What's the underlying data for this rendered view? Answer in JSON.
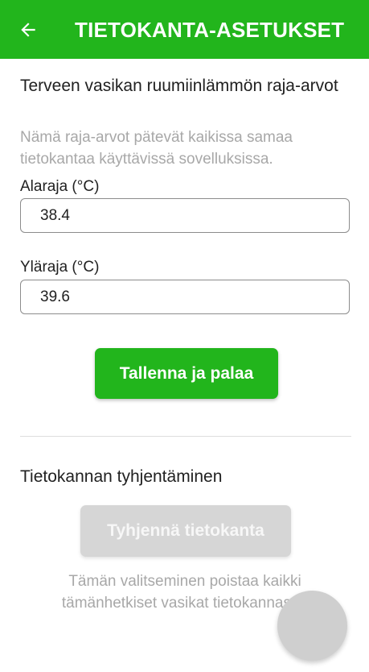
{
  "appbar": {
    "title": "TIETOKANTA-ASETUKSET",
    "back_icon": "arrow-left-icon",
    "color": "#22b51c"
  },
  "temperature_limits": {
    "title": "Terveen vasikan ruumiinlämmön raja-arvot",
    "description": "Nämä raja-arvot pätevät kaikissa samaa tietokantaa käyttävissä sovelluksissa.",
    "lower": {
      "label": "Alaraja (°C)",
      "value": "38.4"
    },
    "upper": {
      "label": "Yläraja (°C)",
      "value": "39.6"
    },
    "save_label": "Tallenna ja palaa"
  },
  "database_clear": {
    "title": "Tietokannan tyhjentäminen",
    "button_label": "Tyhjennä tietokanta",
    "description": "Tämän valitseminen poistaa kaikki tämänhetkiset vasikat tietokannasta."
  },
  "colors": {
    "accent": "#22b51c",
    "disabled_button": "#d6d6d6",
    "hint_text": "#a8a8a8"
  }
}
